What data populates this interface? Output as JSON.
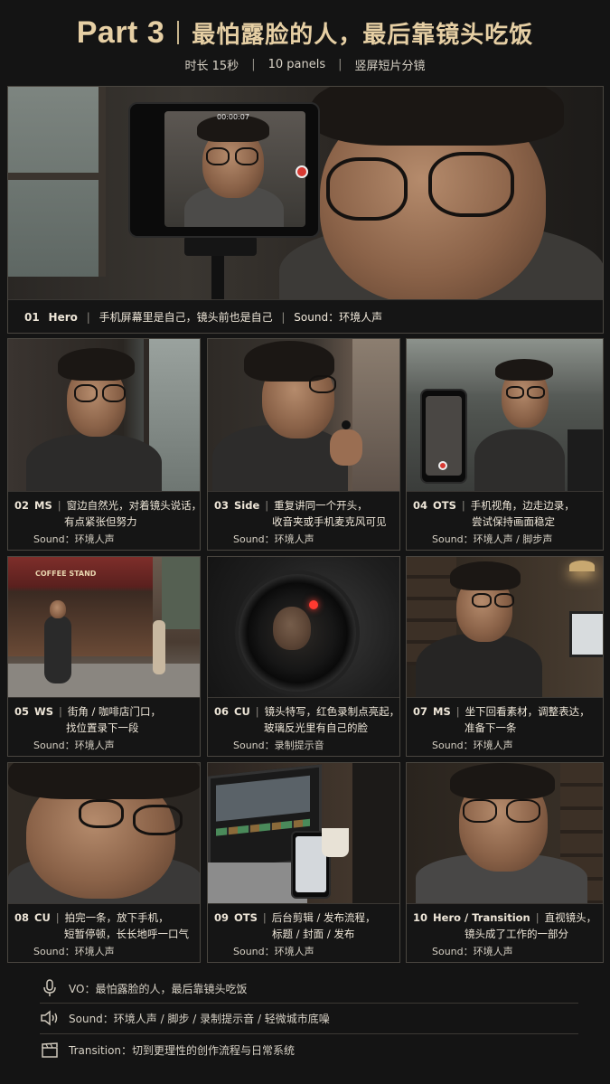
{
  "header": {
    "part": "Part 3",
    "title": "最怕露脸的人，最后靠镜头吃饭",
    "meta": [
      "时长 15秒",
      "10 panels",
      "竖屏短片分镜"
    ]
  },
  "hero": {
    "num": "01",
    "shot": "Hero",
    "desc": "手机屏幕里是自己，镜头前也是自己",
    "sound": "Sound：环境人声",
    "phone_timer": "00:00:07"
  },
  "panels": [
    {
      "num": "02",
      "shot": "MS",
      "line1": "窗边自然光，对着镜头说话，",
      "line2": "有点紧张但努力",
      "sound": "Sound：环境人声"
    },
    {
      "num": "03",
      "shot": "Side",
      "line1": "重复讲同一个开头，",
      "line2": "收音夹或手机麦克风可见",
      "sound": "Sound：环境人声"
    },
    {
      "num": "04",
      "shot": "OTS",
      "line1": "手机视角，边走边录，",
      "line2": "尝试保持画面稳定",
      "sound": "Sound：环境人声 / 脚步声"
    },
    {
      "num": "05",
      "shot": "WS",
      "line1": "街角 / 咖啡店门口，",
      "line2": "找位置录下一段",
      "sound": "Sound：环境人声"
    },
    {
      "num": "06",
      "shot": "CU",
      "line1": "镜头特写，红色录制点亮起，",
      "line2": "玻璃反光里有自己的脸",
      "sound": "Sound：录制提示音"
    },
    {
      "num": "07",
      "shot": "MS",
      "line1": "坐下回看素材，调整表达，",
      "line2": "准备下一条",
      "sound": "Sound：环境人声"
    },
    {
      "num": "08",
      "shot": "CU",
      "line1": "拍完一条，放下手机，",
      "line2": "短暂停顿，长长地呼一口气",
      "sound": "Sound：环境人声"
    },
    {
      "num": "09",
      "shot": "OTS",
      "line1": "后台剪辑 / 发布流程，",
      "line2": "标题 / 封面 / 发布",
      "sound": "Sound：环境人声"
    },
    {
      "num": "10",
      "shot": "Hero / Transition",
      "line1": "直视镜头，",
      "line2": "镜头成了工作的一部分",
      "sound": "Sound：环境人声"
    }
  ],
  "signs": {
    "coffee": "COFFEE STAND"
  },
  "footer": {
    "vo": "VO：最怕露脸的人，最后靠镜头吃饭",
    "sound": "Sound：环境人声 / 脚步 / 录制提示音 / 轻微城市底噪",
    "transition": "Transition：切到更理性的创作流程与日常系统"
  },
  "icons": [
    "microphone-icon",
    "speaker-icon",
    "clapperboard-icon"
  ]
}
